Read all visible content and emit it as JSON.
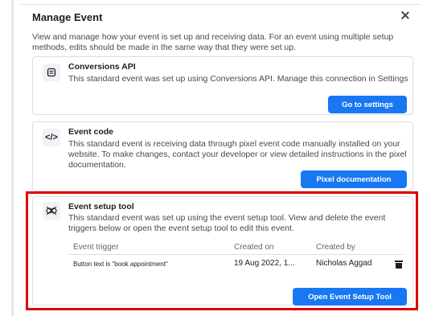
{
  "modal": {
    "title": "Manage Event",
    "close_label": "×",
    "intro": "View and manage how your event is set up and receiving data. For an event using multiple setup methods, edits should be made in the same way that they were set up."
  },
  "cards": [
    {
      "icon": "conversions-api-icon",
      "title": "Conversions API",
      "description": "This standard event was set up using Conversions API. Manage this connection in Settings",
      "button": "Go to settings"
    },
    {
      "icon": "code-icon",
      "icon_glyph": "</>",
      "title": "Event code",
      "description": "This standard event is receiving data through pixel event code manually installed on your website. To make changes, contact your developer or view detailed instructions in the pixel documentation.",
      "button": "Pixel documentation"
    },
    {
      "icon": "event-setup-tool-icon",
      "title": "Event setup tool",
      "description": "This standard event was set up using the event setup tool. View and delete the event triggers below or open the event setup tool to edit this event.",
      "button": "Open Event Setup Tool",
      "table": {
        "headers": [
          "Event trigger",
          "Created on",
          "Created by"
        ],
        "rows": [
          {
            "trigger": "Button text is \"book appointment\"",
            "created_on": "19 Aug 2022, 1...",
            "created_by": "Nicholas Aggad"
          }
        ]
      }
    }
  ],
  "colors": {
    "primary": "#1877f2",
    "highlight": "#e00000",
    "border": "#dadde1"
  }
}
